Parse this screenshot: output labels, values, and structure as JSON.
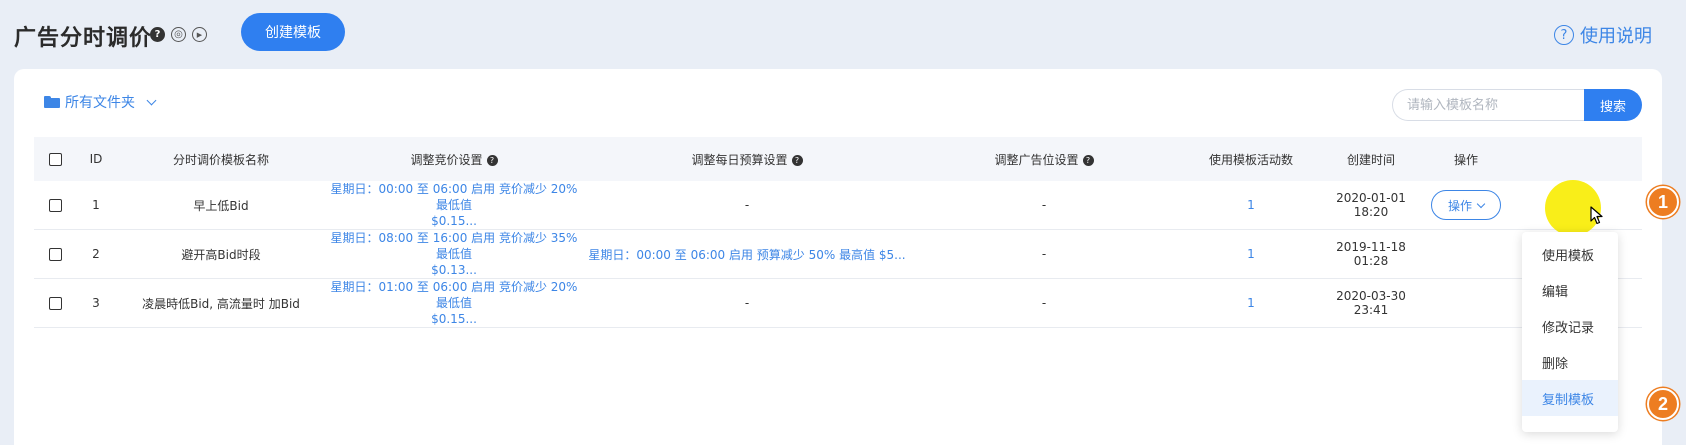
{
  "header": {
    "title": "广告分时调价",
    "create_button": "创建模板",
    "help_link": "使用说明",
    "icons": [
      "question-icon",
      "record-icon",
      "play-icon"
    ]
  },
  "toolbar": {
    "folder_label": "所有文件夹",
    "search_placeholder": "请输入模板名称",
    "search_button": "搜索"
  },
  "table": {
    "columns": [
      "ID",
      "分时调价模板名称",
      "调整竞价设置",
      "调整每日预算设置",
      "调整广告位设置",
      "使用模板活动数",
      "创建时间",
      "操作"
    ],
    "rows": [
      {
        "id": "1",
        "name": "早上低Bid",
        "bid_line1": "星期日：00:00 至 06:00 启用 竞价减少 20% 最低值",
        "bid_line2": "$0.15...",
        "budget": "-",
        "placement": "-",
        "count": "1",
        "created": "2020-01-01 18:20",
        "action": "操作"
      },
      {
        "id": "2",
        "name": "避开高Bid时段",
        "bid_line1": "星期日：08:00 至 16:00 启用 竞价减少 35% 最低值",
        "bid_line2": "$0.13...",
        "budget": "星期日：00:00 至 06:00 启用 预算减少 50% 最高值 $5...",
        "placement": "-",
        "count": "1",
        "created": "2019-11-18 01:28"
      },
      {
        "id": "3",
        "name": "凌晨時低Bid, 高流量时 加Bid",
        "bid_line1": "星期日：01:00 至 06:00 启用 竞价减少 20% 最低值",
        "bid_line2": "$0.15...",
        "budget": "-",
        "placement": "-",
        "count": "1",
        "created": "2020-03-30 23:41"
      }
    ]
  },
  "menu": {
    "items": [
      "使用模板",
      "编辑",
      "修改记录",
      "删除",
      "复制模板"
    ],
    "active_index": 4
  },
  "badges": [
    "1",
    "2"
  ],
  "colors": {
    "accent": "#2f7ff0",
    "link": "#3d86e6",
    "badge": "#ed7d21",
    "highlight": "#f8ec00"
  }
}
